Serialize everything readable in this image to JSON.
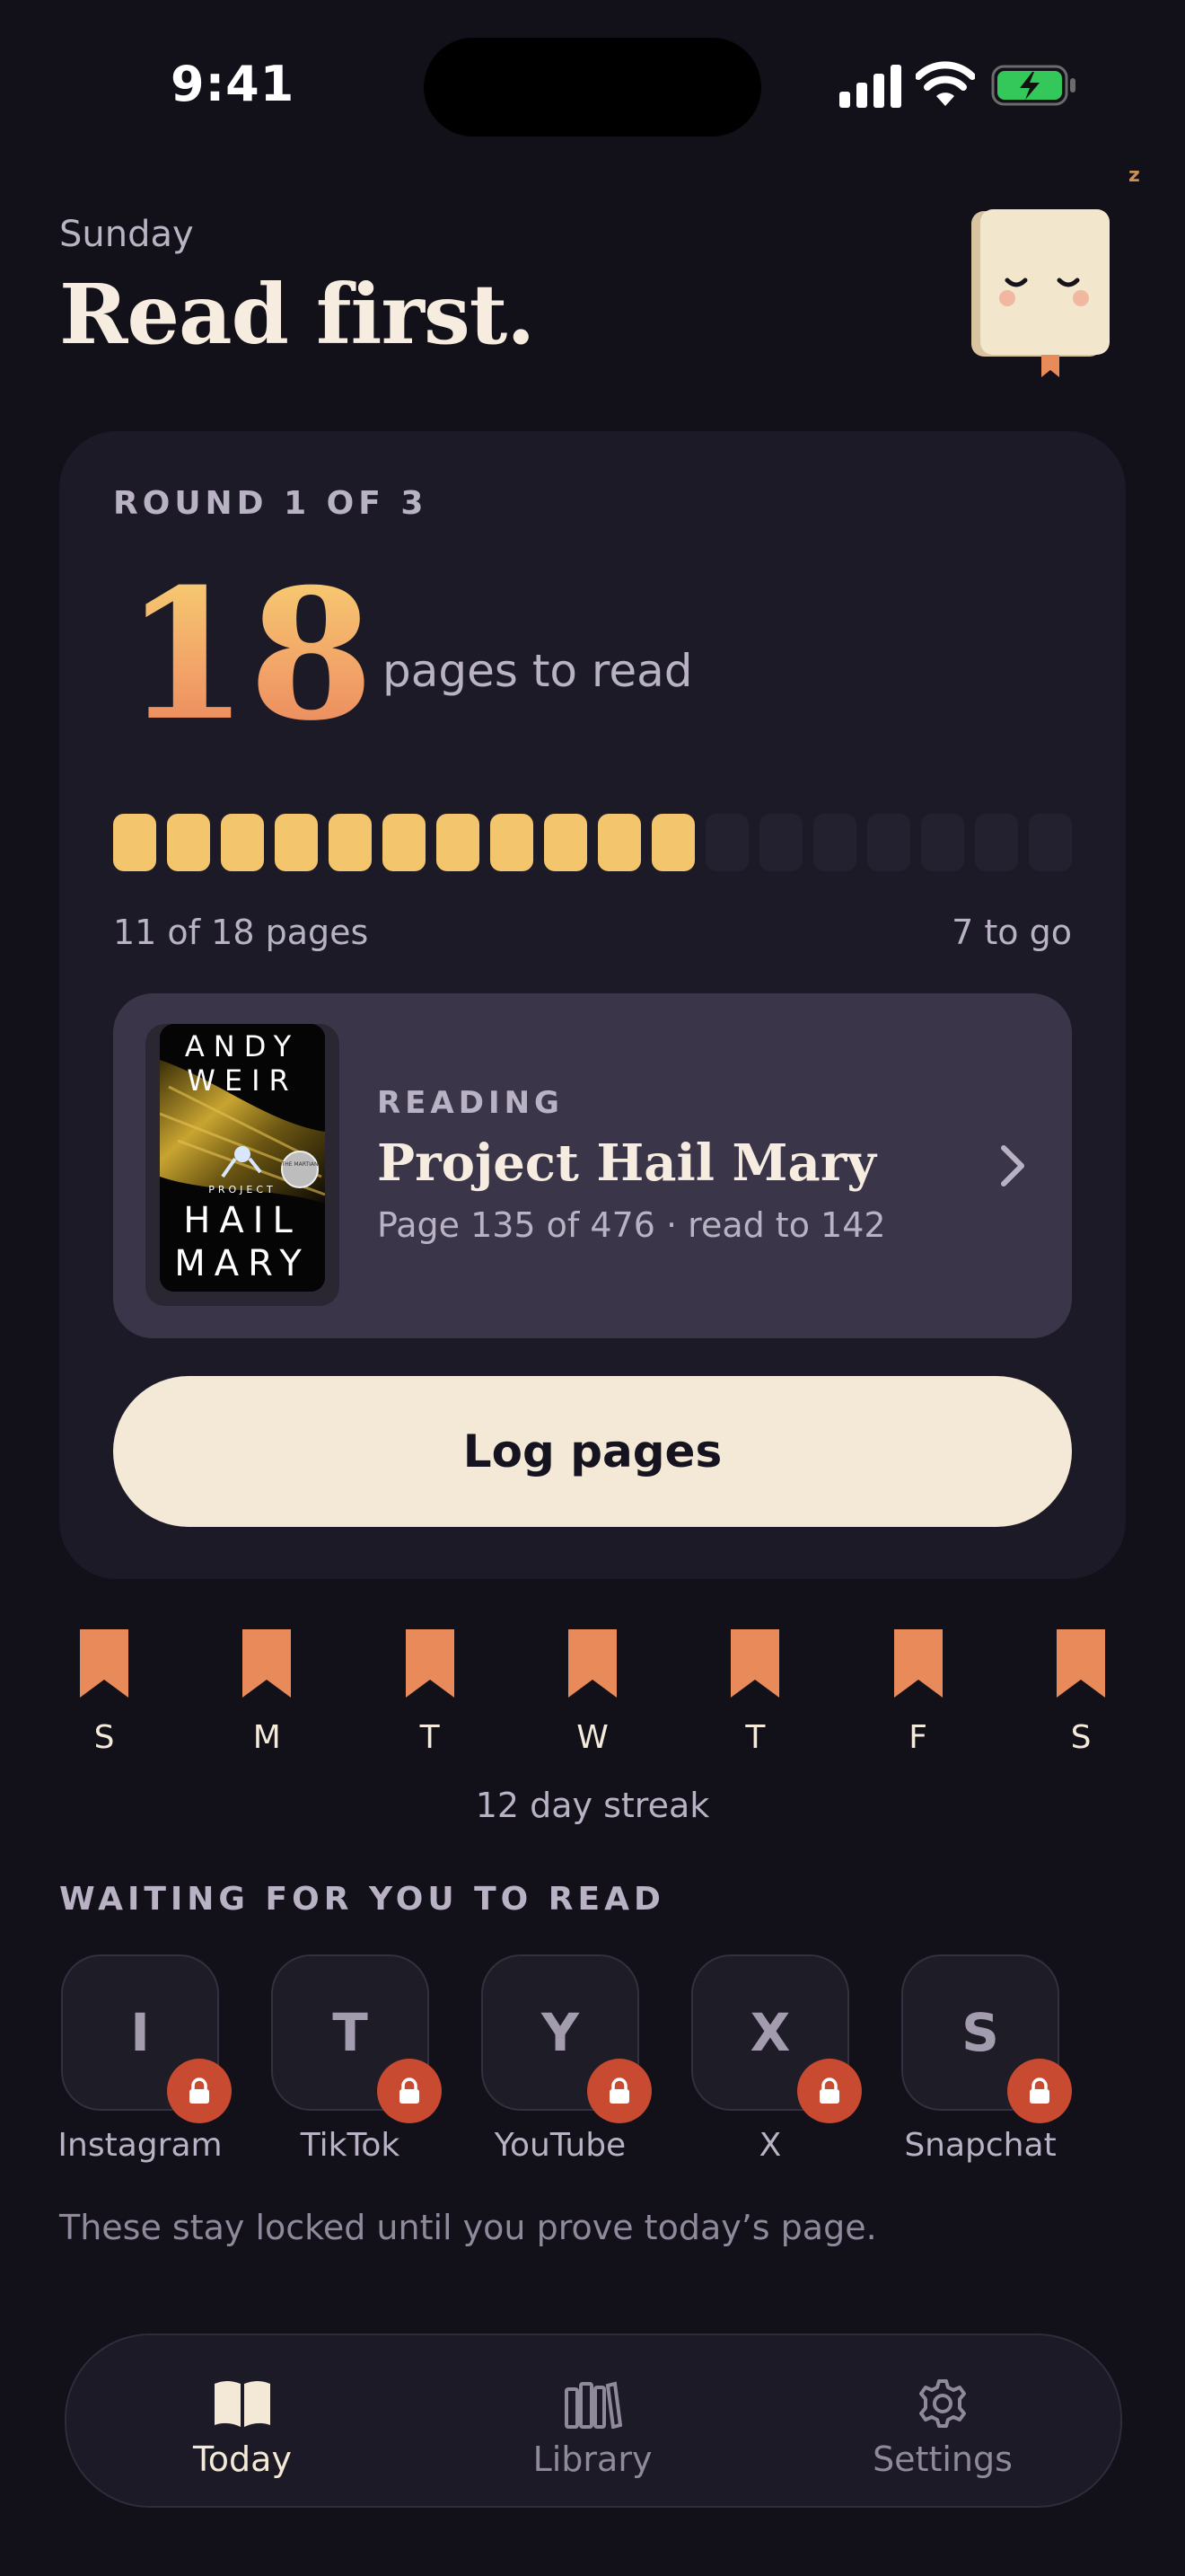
{
  "status_bar": {
    "time": "9:41"
  },
  "header": {
    "day": "Sunday",
    "headline": "Read first."
  },
  "goal": {
    "round_label": "ROUND 1 OF 3",
    "pages_number": "18",
    "pages_label": "pages to read",
    "progress": {
      "done": 11,
      "total": 18
    },
    "progress_left": "11 of 18 pages",
    "progress_right": "7 to go"
  },
  "book": {
    "status_label": "READING",
    "title": "Project Hail Mary",
    "subtitle": "Page 135 of 476 · read to 142",
    "cover": {
      "author": "ANDY WEIR",
      "project": "PROJECT",
      "hail": "HAIL",
      "mary": "MARY",
      "badge": "THE MARTIAN"
    }
  },
  "log_button": "Log pages",
  "week": {
    "days": [
      "S",
      "M",
      "T",
      "W",
      "T",
      "F",
      "S"
    ],
    "streak_label": "12 day streak"
  },
  "waiting": {
    "heading": "WAITING FOR YOU TO READ",
    "apps": [
      {
        "letter": "I",
        "name": "Instagram"
      },
      {
        "letter": "T",
        "name": "TikTok"
      },
      {
        "letter": "Y",
        "name": "YouTube"
      },
      {
        "letter": "X",
        "name": "X"
      },
      {
        "letter": "S",
        "name": "Snapchat"
      }
    ],
    "note": "These stay locked until you prove today’s page."
  },
  "tabs": [
    {
      "label": "Today",
      "icon": "book-open-icon",
      "active": true
    },
    {
      "label": "Library",
      "icon": "library-icon",
      "active": false
    },
    {
      "label": "Settings",
      "icon": "gear-icon",
      "active": false
    }
  ],
  "colors": {
    "background": "#121019",
    "card": "#1c1a26",
    "accent_gold": "#f3c56d",
    "accent_orange": "#e98a5a",
    "lock_red": "#c74a31",
    "button_cream": "#f4e9d6"
  },
  "mascot": {
    "sleep_mark": "z"
  }
}
